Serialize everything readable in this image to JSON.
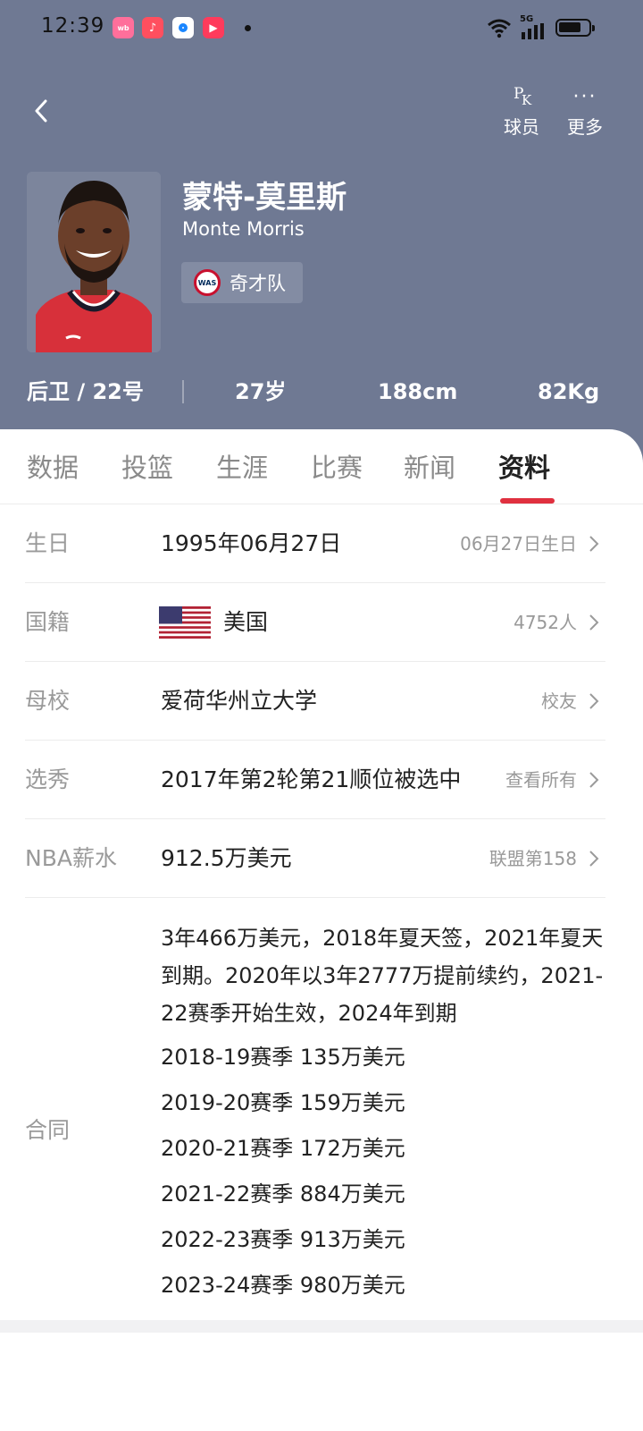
{
  "status_bar": {
    "time": "12:39",
    "network": "5G",
    "app_icons": [
      "weibo-app-icon",
      "music-app-icon",
      "browser-app-icon",
      "video-app-icon"
    ]
  },
  "header": {
    "actions": [
      {
        "label": "球员",
        "icon": "pk-icon"
      },
      {
        "label": "更多",
        "icon": "more-icon"
      }
    ],
    "player": {
      "name_cn": "蒙特-莫里斯",
      "name_en": "Monte Morris",
      "team": "奇才队",
      "team_logo_text": "WAS"
    },
    "stats": {
      "position_number": "后卫 / 22号",
      "age": "27岁",
      "height": "188cm",
      "weight": "82Kg"
    },
    "background_color": "#6f7993"
  },
  "tabs": {
    "items": [
      "数据",
      "投篮",
      "生涯",
      "比赛",
      "新闻",
      "资料"
    ],
    "active": "资料",
    "accent_color": "#e0303f"
  },
  "info": {
    "birthday": {
      "label": "生日",
      "value": "1995年06月27日",
      "extra": "06月27日生日"
    },
    "nationality": {
      "label": "国籍",
      "value": "美国",
      "extra": "4752人",
      "flag": "us-flag-icon"
    },
    "college": {
      "label": "母校",
      "value": "爱荷华州立大学",
      "extra": "校友"
    },
    "draft": {
      "label": "选秀",
      "value": "2017年第2轮第21顺位被选中",
      "extra": "查看所有"
    },
    "salary": {
      "label": "NBA薪水",
      "value": "912.5万美元",
      "extra": "联盟第158"
    },
    "contract": {
      "label": "合同",
      "summary": "3年466万美元，2018年夏天签，2021年夏天到期。2020年以3年2777万提前续约，2021-22赛季开始生效，2024年到期",
      "years": [
        "2018-19赛季 135万美元",
        "2019-20赛季 159万美元",
        "2020-21赛季 172万美元",
        "2021-22赛季 884万美元",
        "2022-23赛季 913万美元",
        "2023-24赛季 980万美元"
      ]
    }
  }
}
